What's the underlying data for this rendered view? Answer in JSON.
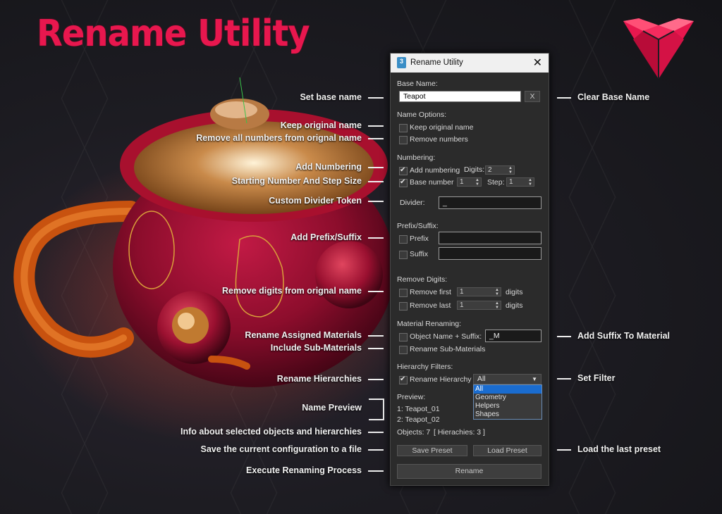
{
  "header": {
    "title": "Rename Utility"
  },
  "dialog": {
    "title": "Rename Utility",
    "app_icon_text": "3",
    "base_name": {
      "label": "Base Name:",
      "value": "Teapot",
      "clear_label": "X"
    },
    "name_options": {
      "label": "Name Options:",
      "keep_original": "Keep original name",
      "remove_numbers": "Remove numbers"
    },
    "numbering": {
      "label": "Numbering:",
      "add_numbering": "Add numbering",
      "digits_label": "Digits:",
      "digits_value": "2",
      "base_number": "Base number",
      "base_value": "1",
      "step_label": "Step:",
      "step_value": "1"
    },
    "divider": {
      "label": "Divider:",
      "value": "_"
    },
    "prefix_suffix": {
      "label": "Prefix/Suffix:",
      "prefix": "Prefix",
      "suffix": "Suffix"
    },
    "remove_digits": {
      "label": "Remove Digits:",
      "remove_first": "Remove first",
      "remove_last": "Remove last",
      "first_value": "1",
      "last_value": "1",
      "digits_unit": "digits"
    },
    "material": {
      "label": "Material Renaming:",
      "object_name_suffix": "Object Name + Suffix:",
      "suffix_value": "_M",
      "sub_materials": "Rename Sub-Materials"
    },
    "hierarchy": {
      "label": "Hierarchy Filters:",
      "rename_hierarchy": "Rename Hierarchy",
      "selected": "All",
      "options": [
        "All",
        "Geometry",
        "Helpers",
        "Shapes"
      ]
    },
    "preview": {
      "label": "Preview:",
      "lines": [
        "1: Teapot_01",
        "2: Teapot_02"
      ]
    },
    "info": {
      "objects": "Objects: 7",
      "hierarchies": "[ Hierachies: 3 ]"
    },
    "buttons": {
      "save_preset": "Save Preset",
      "load_preset": "Load Preset",
      "rename": "Rename"
    }
  },
  "annotations": {
    "left": [
      "Set base name",
      "Keep original name",
      "Remove all numbers from orignal name",
      "Add Numbering",
      "Starting Number And Step Size",
      "Custom Divider Token",
      "Add Prefix/Suffix",
      "Remove digits from orignal name",
      "Rename Assigned Materials",
      "Include Sub-Materials",
      "Rename Hierarchies",
      "Name Preview",
      "Info about selected objects and hierarchies",
      "Save the current configuration to a file",
      "Execute Renaming Process"
    ],
    "right": [
      "Clear Base Name",
      "Add Suffix To Material",
      "Set Filter",
      "Load the last preset"
    ]
  },
  "colors": {
    "title": "#e8174e",
    "logo": "#e8174e",
    "selection": "#1a6ccf"
  }
}
